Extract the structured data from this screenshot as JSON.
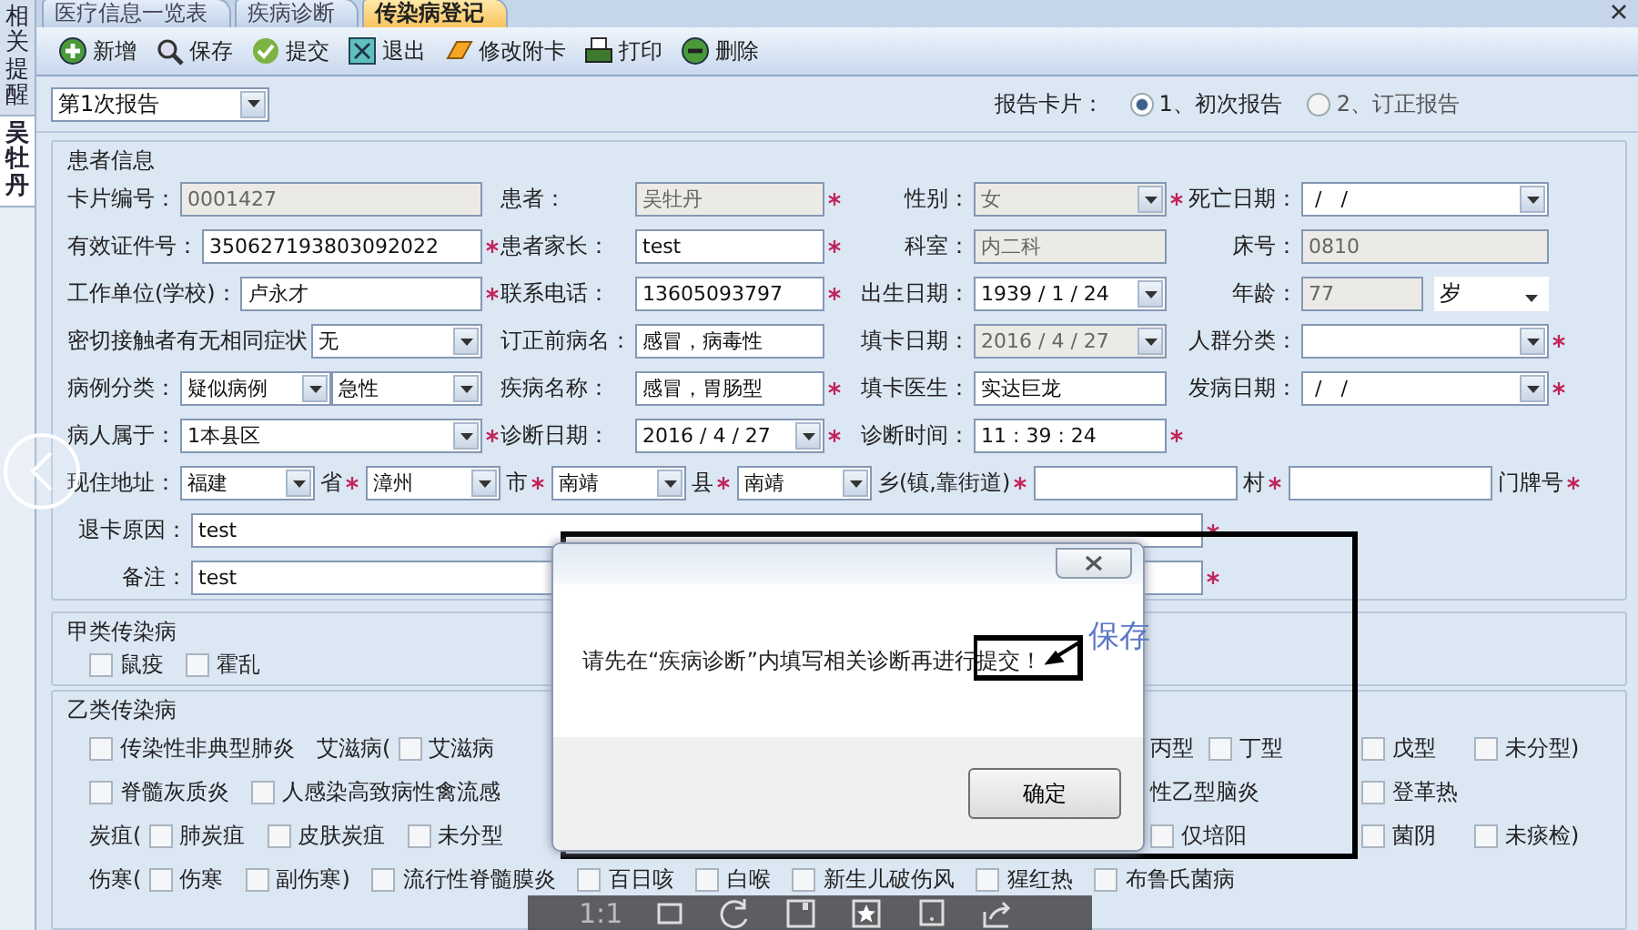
{
  "sidebar": {
    "items": [
      {
        "label": "相关提醒",
        "selected": false
      },
      {
        "label": "吴牡丹",
        "selected": true
      }
    ]
  },
  "tabs": [
    {
      "label": "医疗信息一览表",
      "selected": false
    },
    {
      "label": "疾病诊断",
      "selected": false
    },
    {
      "label": "传染病登记",
      "selected": true
    }
  ],
  "toolbar": [
    {
      "label": "新增",
      "kind": "add"
    },
    {
      "label": "保存",
      "kind": "search"
    },
    {
      "label": "提交",
      "kind": "check"
    },
    {
      "label": "退出",
      "kind": "exit"
    },
    {
      "label": "修改附卡",
      "kind": "eraser"
    },
    {
      "label": "打印",
      "kind": "print"
    },
    {
      "label": "删除",
      "kind": "remove"
    }
  ],
  "report_select": {
    "value": "第1次报告"
  },
  "report_card": {
    "label": "报告卡片：",
    "options": [
      {
        "label": "1、初次报告",
        "selected": true
      },
      {
        "label": "2、订正报告",
        "selected": false
      }
    ]
  },
  "patient_info": {
    "title": "患者信息",
    "rows": [
      [
        {
          "label": "卡片编号：",
          "required": false,
          "controls": [
            {
              "kind": "text",
              "value": "0001427",
              "disabled": true
            }
          ]
        },
        {
          "label": "患者：",
          "required": true,
          "controls": [
            {
              "kind": "text",
              "value": "吴牡丹",
              "disabled": true
            }
          ]
        },
        {
          "label": "性别：",
          "required": true,
          "controls": [
            {
              "kind": "select",
              "value": "女",
              "disabled": true
            }
          ]
        },
        {
          "label": "死亡日期：",
          "required": false,
          "controls": [
            {
              "kind": "select",
              "value": " /   /",
              "disabled": false
            }
          ]
        }
      ],
      [
        {
          "label": "有效证件号：",
          "required": true,
          "controls": [
            {
              "kind": "text",
              "value": "350627193803092022",
              "disabled": false
            }
          ]
        },
        {
          "label": "患者家长：",
          "required": true,
          "controls": [
            {
              "kind": "text",
              "value": "test",
              "disabled": false
            }
          ]
        },
        {
          "label": "科室：",
          "required": false,
          "controls": [
            {
              "kind": "text",
              "value": "内二科",
              "disabled": true
            }
          ]
        },
        {
          "label": "床号：",
          "required": false,
          "controls": [
            {
              "kind": "text",
              "value": "0810",
              "disabled": true
            }
          ]
        }
      ],
      [
        {
          "label": "工作单位(学校)：",
          "required": true,
          "controls": [
            {
              "kind": "text",
              "value": "卢永才",
              "disabled": false
            }
          ]
        },
        {
          "label": "联系电话：",
          "required": true,
          "controls": [
            {
              "kind": "text",
              "value": "13605093797",
              "disabled": false
            }
          ]
        },
        {
          "label": "出生日期：",
          "required": false,
          "controls": [
            {
              "kind": "select",
              "value": "1939 / 1 / 24",
              "disabled": false
            }
          ]
        },
        {
          "label": "年龄：",
          "required": false,
          "controls": [
            {
              "kind": "text",
              "value": "77",
              "disabled": true
            },
            {
              "kind": "dropdown",
              "value": "岁",
              "disabled": false
            }
          ]
        }
      ],
      [
        {
          "label": "密切接触者有无相同症状",
          "required": false,
          "controls": [
            {
              "kind": "select",
              "value": "无",
              "disabled": false
            }
          ]
        },
        {
          "label": "订正前病名：",
          "required": false,
          "controls": [
            {
              "kind": "text",
              "value": "感冒，病毒性",
              "disabled": false
            }
          ]
        },
        {
          "label": "填卡日期：",
          "required": false,
          "controls": [
            {
              "kind": "select",
              "value": "2016 / 4 / 27",
              "disabled": true
            }
          ]
        },
        {
          "label": "人群分类：",
          "required": true,
          "controls": [
            {
              "kind": "select",
              "disabled": false
            }
          ]
        }
      ],
      [
        {
          "label": "病例分类：",
          "required": false,
          "controls": [
            {
              "kind": "select",
              "value": "疑似病例",
              "disabled": false
            },
            {
              "kind": "select",
              "value": "急性",
              "disabled": false
            }
          ]
        },
        {
          "label": "疾病名称：",
          "required": true,
          "controls": [
            {
              "kind": "text",
              "value": "感冒，胃肠型",
              "disabled": false
            }
          ]
        },
        {
          "label": "填卡医生：",
          "required": false,
          "controls": [
            {
              "kind": "text",
              "value": "实达巨龙",
              "disabled": false
            }
          ]
        },
        {
          "label": "发病日期：",
          "required": true,
          "controls": [
            {
              "kind": "select",
              "value": " /   /",
              "disabled": false
            }
          ]
        }
      ],
      [
        {
          "label": "病人属于：",
          "required": true,
          "controls": [
            {
              "kind": "select",
              "value": "1本县区",
              "disabled": false
            }
          ]
        },
        {
          "label": "诊断日期：",
          "required": true,
          "controls": [
            {
              "kind": "select",
              "value": "2016 / 4 / 27",
              "disabled": false
            }
          ]
        },
        {
          "label": "诊断时间：",
          "required": true,
          "controls": [
            {
              "kind": "text",
              "value": "11 : 39 : 24",
              "disabled": false
            }
          ]
        }
      ]
    ],
    "address": {
      "label": "现住地址：",
      "parts": [
        {
          "kind": "select",
          "value": "福建",
          "suffix": "省",
          "required": true
        },
        {
          "kind": "select",
          "value": "漳州",
          "suffix": "市",
          "required": true
        },
        {
          "kind": "select",
          "value": "南靖",
          "suffix": "县",
          "required": true
        },
        {
          "kind": "select",
          "value": "南靖",
          "suffix": "乡(镇,靠街道)",
          "required": true
        },
        {
          "kind": "text",
          "suffix": "村",
          "required": true
        },
        {
          "kind": "text",
          "suffix": "门牌号",
          "required": true
        }
      ]
    },
    "notes": [
      {
        "label": "退卡原因：",
        "value": "test",
        "required": true
      },
      {
        "label": "备注：",
        "value": "test",
        "required": true
      }
    ]
  },
  "class_a": {
    "title": "甲类传染病",
    "items": [
      {
        "kind": "check",
        "label": "鼠疫",
        "checked": false
      },
      {
        "kind": "check",
        "label": "霍乱",
        "checked": false
      }
    ]
  },
  "class_b": {
    "title": "乙类传染病",
    "rows": [
      {
        "left": [
          {
            "kind": "check",
            "label": "传染性非典型肺炎",
            "checked": false
          },
          {
            "kind": "text",
            "label": "艾滋病("
          },
          {
            "kind": "check",
            "label": "艾滋病",
            "checked": false
          }
        ],
        "right": [
          {
            "kind": "text",
            "label": "丙型"
          },
          {
            "kind": "check",
            "label": "丁型",
            "checked": false
          },
          {
            "kind": "check",
            "label": "戊型",
            "checked": false
          },
          {
            "kind": "check",
            "label": "未分型)",
            "checked": false
          }
        ]
      },
      {
        "left": [
          {
            "kind": "check",
            "label": "脊髓灰质炎",
            "checked": false
          },
          {
            "kind": "check",
            "label": "人感染高致病性禽流感",
            "checked": false
          }
        ],
        "right": [
          {
            "kind": "text",
            "label": "性乙型脑炎"
          },
          {
            "kind": "check",
            "label": "登革热",
            "checked": false
          }
        ]
      },
      {
        "left": [
          {
            "kind": "text",
            "label": "炭疽("
          },
          {
            "kind": "check",
            "label": "肺炭疽",
            "checked": false
          },
          {
            "kind": "check",
            "label": "皮肤炭疽",
            "checked": false
          },
          {
            "kind": "check",
            "label": "未分型",
            "checked": false
          }
        ],
        "right": [
          {
            "kind": "check",
            "label": "仅培阳",
            "checked": false
          },
          {
            "kind": "check",
            "label": "菌阴",
            "checked": false
          },
          {
            "kind": "check",
            "label": "未痰检)",
            "checked": false
          }
        ]
      },
      {
        "left": [
          {
            "kind": "text",
            "label": "伤寒("
          },
          {
            "kind": "check",
            "label": "伤寒",
            "checked": false
          },
          {
            "kind": "check",
            "label": "副伤寒)",
            "checked": false
          },
          {
            "kind": "check",
            "label": "流行性脊髓膜炎",
            "checked": false
          },
          {
            "kind": "check",
            "label": "百日咳",
            "checked": false
          },
          {
            "kind": "check",
            "label": "白喉",
            "checked": false
          },
          {
            "kind": "check",
            "label": "新生儿破伤风",
            "checked": false
          },
          {
            "kind": "check",
            "label": "猩红热",
            "checked": false
          },
          {
            "kind": "check",
            "label": "布鲁氏菌病",
            "checked": false
          }
        ],
        "right": []
      }
    ]
  },
  "dialog": {
    "message": "请先在“疾病诊断”内填写相关诊断再进行提交！",
    "ok": "确定"
  },
  "annotation": {
    "text": "保存"
  },
  "viewer_bar": {
    "zoom_label": "1:1"
  }
}
